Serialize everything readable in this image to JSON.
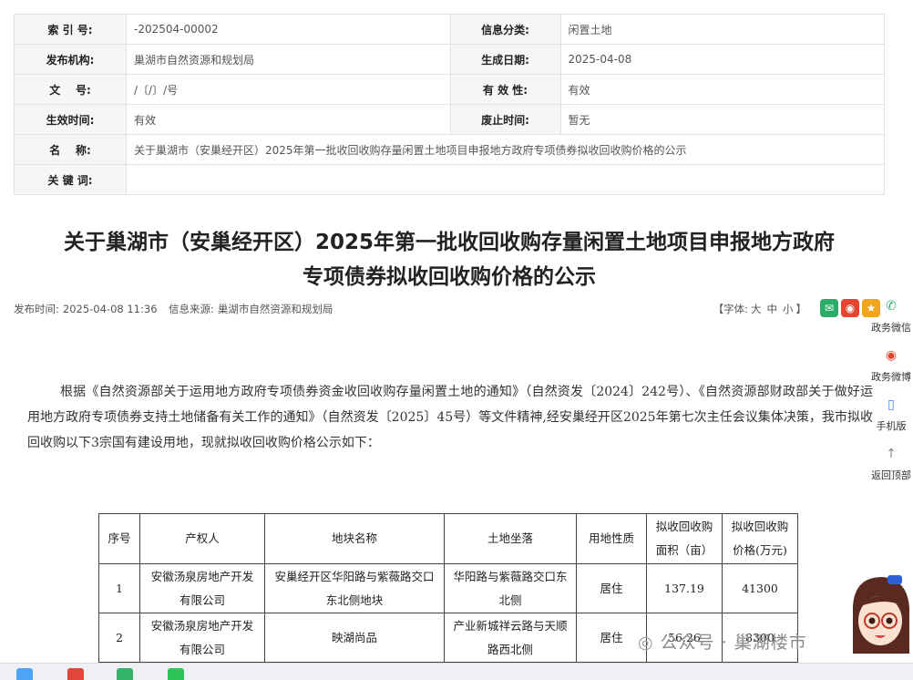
{
  "meta": {
    "index_label": "索 引 号:",
    "index_value": "-202504-00002",
    "category_label": "信息分类:",
    "category_value": "闲置土地",
    "publisher_label": "发布机构:",
    "publisher_value": "巢湖市自然资源和规划局",
    "date_label": "生成日期:",
    "date_value": "2025-04-08",
    "docno_label": "文    号:",
    "docno_value": "/〔/〕/号",
    "validity_label": "有 效 性:",
    "validity_value": "有效",
    "effective_label": "生效时间:",
    "effective_value": "有效",
    "expiry_label": "废止时间:",
    "expiry_value": "暂无",
    "name_label": "名    称:",
    "name_value": "关于巢湖市（安巢经开区）2025年第一批收回收购存量闲置土地项目申报地方政府专项债券拟收回收购价格的公示",
    "keywords_label": "关 键 词:",
    "keywords_value": ""
  },
  "article": {
    "title_line1": "关于巢湖市（安巢经开区）2025年第一批收回收购存量闲置土地项目申报地方政府",
    "title_line2": "专项债券拟收回收购价格的公示",
    "pub_label": "发布时间:",
    "pub_value": "2025-04-08 11:36",
    "source_label": "信息来源:",
    "source_value": "巢湖市自然资源和规划局",
    "font_label": "【字体:",
    "font_large": "大",
    "font_medium": "中",
    "font_small": "小",
    "font_close": "】",
    "paragraph": "根据《自然资源部关于运用地方政府专项债券资金收回收购存量闲置土地的通知》（自然资发〔2024〕242号）、《自然资源部财政部关于做好运用地方政府专项债券支持土地储备有关工作的通知》（自然资发〔2025〕45号）等文件精神,经安巢经开区2025年第七次主任会议集体决策，我市拟收回收购以下3宗国有建设用地，现就拟收回收购价格公示如下："
  },
  "table": {
    "headers": {
      "seq": "序号",
      "owner": "产权人",
      "parcel": "地块名称",
      "location": "土地坐落",
      "use": "用地性质",
      "area_l1": "拟收回收购",
      "area_l2": "面积（亩）",
      "price_l1": "拟收回收购",
      "price_l2": "价格(万元)"
    },
    "rows": [
      {
        "seq": "1",
        "owner_l1": "安徽汤泉房地产开发",
        "owner_l2": "有限公司",
        "parcel_l1": "安巢经开区华阳路与紫薇路交口",
        "parcel_l2": "东北侧地块",
        "location_l1": "华阳路与紫薇路交口东",
        "location_l2": "北侧",
        "use": "居住",
        "area": "137.19",
        "price": "41300"
      },
      {
        "seq": "2",
        "owner_l1": "安徽汤泉房地产开发",
        "owner_l2": "有限公司",
        "parcel_l1": "映湖尚品",
        "parcel_l2": "",
        "location_l1": "产业新城祥云路与天顺",
        "location_l2": "路西北侧",
        "use": "居住",
        "area": "56.26",
        "price": "8300"
      }
    ]
  },
  "sidebar": {
    "wechat": "政务微信",
    "weibo": "政务微博",
    "mobile": "手机版",
    "top": "返回顶部"
  },
  "watermark": "公众号 · 巢湖楼市",
  "colors": {
    "wechat": "#2aae67",
    "weibo": "#e6442e",
    "star": "#f3a51a",
    "meta_key_bg": "#f6f6f6"
  }
}
